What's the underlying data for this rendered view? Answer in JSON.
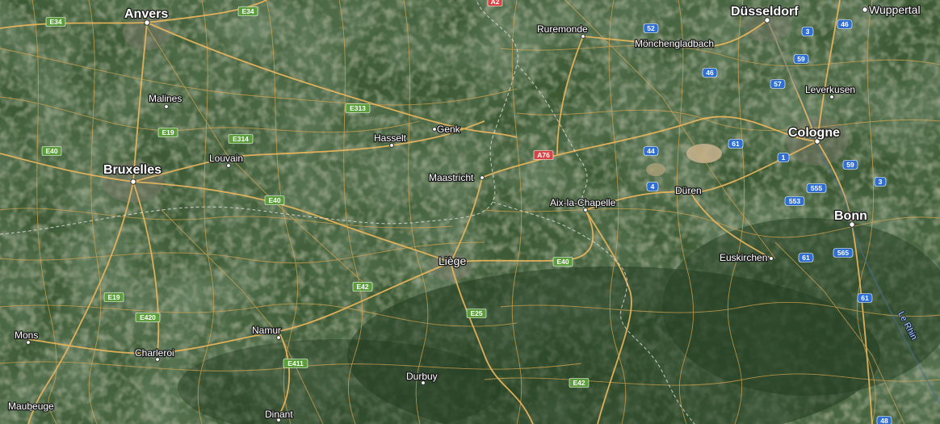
{
  "map": {
    "type": "satellite-hybrid",
    "river_label": "Le Rhin",
    "cities": [
      {
        "id": "anvers",
        "label": "Anvers",
        "size": "big"
      },
      {
        "id": "bruxelles",
        "label": "Bruxelles",
        "size": "big"
      },
      {
        "id": "malines",
        "label": "Malines",
        "size": "sm"
      },
      {
        "id": "louvain",
        "label": "Louvain",
        "size": "sm"
      },
      {
        "id": "hasselt",
        "label": "Hasselt",
        "size": "sm"
      },
      {
        "id": "genk",
        "label": "Genk",
        "size": "sm"
      },
      {
        "id": "maastricht",
        "label": "Maastricht",
        "size": "sm"
      },
      {
        "id": "ruremonde",
        "label": "Ruremonde",
        "size": "sm"
      },
      {
        "id": "monchengladbach",
        "label": "Mönchengladbach",
        "size": "sm"
      },
      {
        "id": "dusseldorf",
        "label": "Düsseldorf",
        "size": "big"
      },
      {
        "id": "wuppertal",
        "label": "Wuppertal",
        "size": "mid"
      },
      {
        "id": "leverkusen",
        "label": "Leverkusen",
        "size": "sm"
      },
      {
        "id": "cologne",
        "label": "Cologne",
        "size": "big"
      },
      {
        "id": "duren",
        "label": "Düren",
        "size": "sm"
      },
      {
        "id": "aix",
        "label": "Aix-la-Chapelle",
        "size": "sm"
      },
      {
        "id": "bonn",
        "label": "Bonn",
        "size": "big"
      },
      {
        "id": "euskirchen",
        "label": "Euskirchen",
        "size": "sm"
      },
      {
        "id": "liege",
        "label": "Liège",
        "size": "mid"
      },
      {
        "id": "namur",
        "label": "Namur",
        "size": "sm"
      },
      {
        "id": "charleroi",
        "label": "Charleroi",
        "size": "sm"
      },
      {
        "id": "mons",
        "label": "Mons",
        "size": "sm"
      },
      {
        "id": "maubeuge",
        "label": "Maubeuge",
        "size": "sm"
      },
      {
        "id": "dinant",
        "label": "Dinant",
        "size": "sm"
      },
      {
        "id": "durbuy",
        "label": "Durbuy",
        "size": "sm"
      }
    ],
    "shields": [
      {
        "id": "e34a",
        "label": "E34",
        "kind": "green"
      },
      {
        "id": "e34b",
        "label": "E34",
        "kind": "green"
      },
      {
        "id": "e19a",
        "label": "E19",
        "kind": "green"
      },
      {
        "id": "e40a",
        "label": "E40",
        "kind": "green"
      },
      {
        "id": "e314",
        "label": "E314",
        "kind": "green"
      },
      {
        "id": "e313",
        "label": "E313",
        "kind": "green"
      },
      {
        "id": "e40b",
        "label": "E40",
        "kind": "green"
      },
      {
        "id": "e42a",
        "label": "E42",
        "kind": "green"
      },
      {
        "id": "e19b",
        "label": "E19",
        "kind": "green"
      },
      {
        "id": "e420",
        "label": "E420",
        "kind": "green"
      },
      {
        "id": "e411",
        "label": "E411",
        "kind": "green"
      },
      {
        "id": "e25",
        "label": "E25",
        "kind": "green"
      },
      {
        "id": "e40c",
        "label": "E40",
        "kind": "green"
      },
      {
        "id": "e42b",
        "label": "E42",
        "kind": "green"
      },
      {
        "id": "a76",
        "label": "A76",
        "kind": "red"
      },
      {
        "id": "a2",
        "label": "A2",
        "kind": "red"
      },
      {
        "id": "b52",
        "label": "52",
        "kind": "blue"
      },
      {
        "id": "b46a",
        "label": "46",
        "kind": "blue"
      },
      {
        "id": "b3a",
        "label": "3",
        "kind": "blue"
      },
      {
        "id": "b46b",
        "label": "46",
        "kind": "blue"
      },
      {
        "id": "b59a",
        "label": "59",
        "kind": "blue"
      },
      {
        "id": "b57",
        "label": "57",
        "kind": "blue"
      },
      {
        "id": "b44",
        "label": "44",
        "kind": "blue"
      },
      {
        "id": "b61a",
        "label": "61",
        "kind": "blue"
      },
      {
        "id": "b1",
        "label": "1",
        "kind": "blue"
      },
      {
        "id": "b4",
        "label": "4",
        "kind": "blue"
      },
      {
        "id": "b555",
        "label": "555",
        "kind": "blue"
      },
      {
        "id": "b59b",
        "label": "59",
        "kind": "blue"
      },
      {
        "id": "b3b",
        "label": "3",
        "kind": "blue"
      },
      {
        "id": "b553",
        "label": "553",
        "kind": "blue"
      },
      {
        "id": "b565",
        "label": "565",
        "kind": "blue"
      },
      {
        "id": "b61b",
        "label": "61",
        "kind": "blue"
      },
      {
        "id": "b61c",
        "label": "61",
        "kind": "blue"
      },
      {
        "id": "b48",
        "label": "48",
        "kind": "blue"
      }
    ],
    "colors": {
      "road": "#e7b45c",
      "border": "#d9d9d9",
      "shield_green": "#5c9e3b",
      "shield_blue": "#2f6fd1",
      "shield_red": "#d64545"
    }
  }
}
